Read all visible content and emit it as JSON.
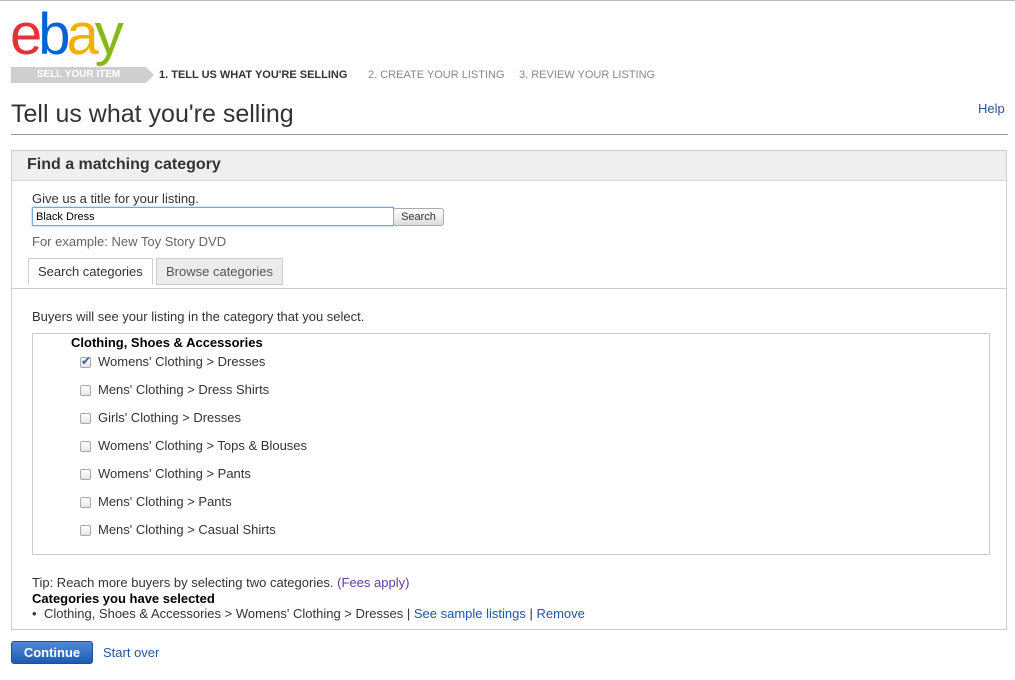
{
  "logo": {
    "letters": [
      {
        "char": "e",
        "color": "#e53238"
      },
      {
        "char": "b",
        "color": "#0064d2"
      },
      {
        "char": "a",
        "color": "#f5af02"
      },
      {
        "char": "y",
        "color": "#86b817"
      }
    ]
  },
  "steps": {
    "badge": "SELL YOUR ITEM",
    "items": [
      {
        "label": "1. TELL US WHAT YOU'RE SELLING",
        "current": true
      },
      {
        "label": "2. CREATE YOUR LISTING",
        "current": false
      },
      {
        "label": "3. REVIEW YOUR LISTING",
        "current": false
      }
    ]
  },
  "header": {
    "title": "Tell us what you're selling",
    "help_label": "Help"
  },
  "panel": {
    "heading": "Find a matching category",
    "title_prompt": "Give us a title for your listing.",
    "title_value": "Black Dress",
    "search_label": "Search",
    "example": "For example: New Toy Story DVD",
    "tabs": [
      {
        "label": "Search categories",
        "active": true
      },
      {
        "label": "Browse categories",
        "active": false
      }
    ],
    "buyers_note": "Buyers will see your listing in the category that you select.",
    "category_group": "Clothing, Shoes & Accessories",
    "categories": [
      {
        "label": "Womens' Clothing > Dresses",
        "checked": true
      },
      {
        "label": "Mens' Clothing > Dress Shirts",
        "checked": false
      },
      {
        "label": "Girls' Clothing > Dresses",
        "checked": false
      },
      {
        "label": "Womens' Clothing > Tops & Blouses",
        "checked": false
      },
      {
        "label": "Womens' Clothing > Pants",
        "checked": false
      },
      {
        "label": "Mens' Clothing > Pants",
        "checked": false
      },
      {
        "label": "Mens' Clothing > Casual Shirts",
        "checked": false
      }
    ],
    "tip": "Tip: Reach more buyers by selecting two categories.",
    "fees_link": "(Fees apply)",
    "selected_heading": "Categories you have selected",
    "selected_item": "Clothing, Shoes & Accessories > Womens' Clothing > Dresses",
    "separator": "|",
    "sample_link": "See sample listings",
    "remove_link": "Remove"
  },
  "footer": {
    "continue_label": "Continue",
    "start_over_label": "Start over"
  }
}
